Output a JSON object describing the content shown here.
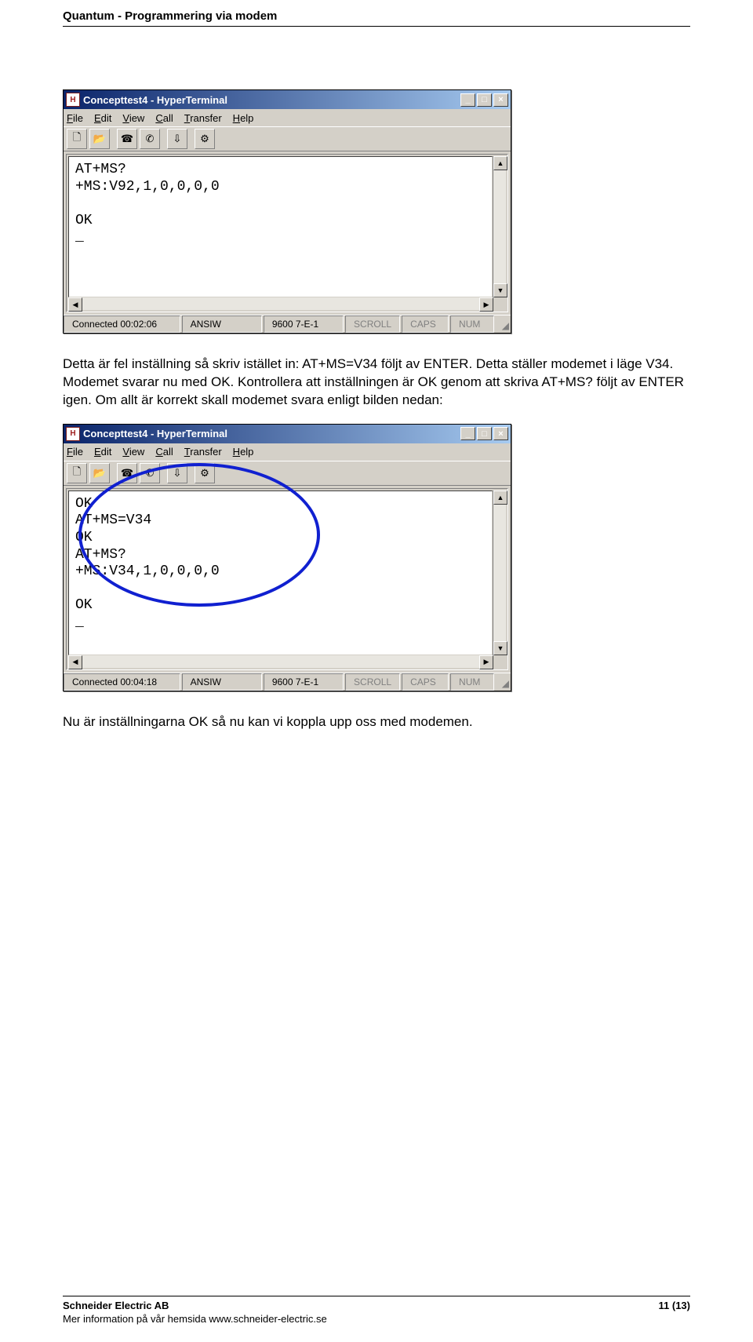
{
  "header": {
    "title": "Quantum - Programmering via modem"
  },
  "para1": "Detta är fel inställning så skriv istället in: AT+MS=V34 följt av ENTER. Detta ställer modemet i läge V34. Modemet svarar nu med OK. Kontrollera att inställningen är OK genom att skriva AT+MS? följt av ENTER igen. Om allt är korrekt skall modemet svara enligt bilden nedan:",
  "para2": "Nu är inställningarna OK så nu kan vi koppla upp oss med modemen.",
  "window1": {
    "title": "Concepttest4 - HyperTerminal",
    "menus": [
      "File",
      "Edit",
      "View",
      "Call",
      "Transfer",
      "Help"
    ],
    "console": "AT+MS?\n+MS:V92,1,0,0,0,0\n\nOK\n_",
    "status": {
      "connected": "Connected 00:02:06",
      "emu": "ANSIW",
      "cfg": "9600 7-E-1",
      "scroll": "SCROLL",
      "caps": "CAPS",
      "num": "NUM"
    }
  },
  "window2": {
    "title": "Concepttest4 - HyperTerminal",
    "menus": [
      "File",
      "Edit",
      "View",
      "Call",
      "Transfer",
      "Help"
    ],
    "console": "OK\nAT+MS=V34\nOK\nAT+MS?\n+MS:V34,1,0,0,0,0\n\nOK\n_",
    "status": {
      "connected": "Connected 00:04:18",
      "emu": "ANSIW",
      "cfg": "9600 7-E-1",
      "scroll": "SCROLL",
      "caps": "CAPS",
      "num": "NUM"
    }
  },
  "footer": {
    "company": "Schneider Electric AB",
    "info": "Mer information på vår hemsida www.schneider-electric.se",
    "page": "11 (13)"
  }
}
